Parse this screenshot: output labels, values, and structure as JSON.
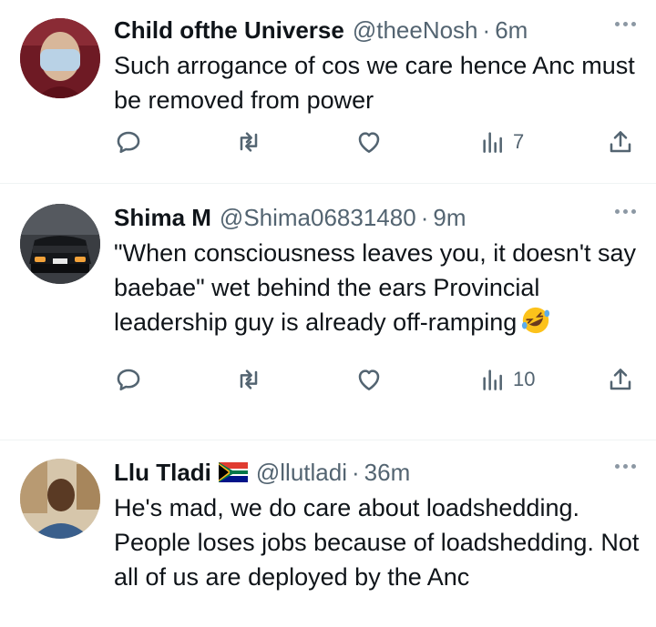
{
  "tweets": [
    {
      "name": "Child ofthe Universe",
      "handle": "@theeNosh",
      "time": "6m",
      "text": "Such arrogance of cos we care hence Anc must be removed from power",
      "views": "7"
    },
    {
      "name": "Shima M",
      "handle": "@Shima06831480",
      "time": "9m",
      "text": "\"When consciousness leaves you, it doesn't say baebae\" wet behind the ears Provincial leadership guy is already off-ramping",
      "emoji": "rolling-on-floor-laughing",
      "views": "10"
    },
    {
      "name": "Llu Tladi",
      "flag": "south-africa-flag",
      "handle": "@llutladi",
      "time": "36m",
      "text": "He's mad, we do care about loadshedding. People loses jobs because of loadshedding. Not all of us are deployed by the Anc"
    }
  ],
  "separator": "·",
  "icons": [
    "reply-icon",
    "retweet-icon",
    "like-icon",
    "views-icon",
    "share-icon",
    "more-icon"
  ],
  "colors": {
    "text": "#0f1419",
    "secondary": "#536471",
    "divider": "#eff3f4"
  }
}
